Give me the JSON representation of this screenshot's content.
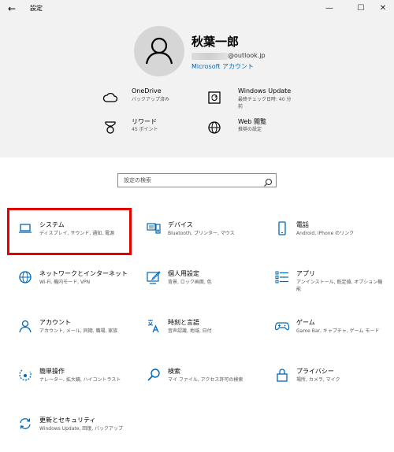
{
  "window": {
    "title": "設定",
    "controls": {
      "back": "←",
      "minimize": "—",
      "maximize": "☐",
      "close": "✕"
    }
  },
  "profile": {
    "name": "秋葉一郎",
    "email_domain": "@outlook.jp",
    "account_link": "Microsoft アカウント",
    "avatar_icon": "person-icon"
  },
  "quick": [
    {
      "label": "OneDrive",
      "sub": "バックアップ済み",
      "icon": "cloud-icon"
    },
    {
      "label": "Windows Update",
      "sub": "最終チェック日時: 40 分前",
      "icon": "update-icon"
    },
    {
      "label": "リワード",
      "sub": "45 ポイント",
      "icon": "medal-icon"
    },
    {
      "label": "Web 閲覧",
      "sub": "推奨の設定",
      "icon": "globe-icon"
    }
  ],
  "search": {
    "placeholder": "設定の検索"
  },
  "categories": [
    {
      "label": "システム",
      "sub": "ディスプレイ, サウンド, 通知, 電源",
      "icon": "laptop-icon"
    },
    {
      "label": "デバイス",
      "sub": "Bluetooth, プリンター, マウス",
      "icon": "devices-icon"
    },
    {
      "label": "電話",
      "sub": "Android, iPhone のリンク",
      "icon": "phone-icon"
    },
    {
      "label": "ネットワークとインターネット",
      "sub": "Wi-Fi, 機内モード, VPN",
      "icon": "network-globe-icon"
    },
    {
      "label": "個人用設定",
      "sub": "背景, ロック画面, 色",
      "icon": "personalize-icon"
    },
    {
      "label": "アプリ",
      "sub": "アンインストール, 既定値, オプション機能",
      "icon": "apps-list-icon"
    },
    {
      "label": "アカウント",
      "sub": "アカウント, メール, 同期, 職場, 家族",
      "icon": "account-icon"
    },
    {
      "label": "時刻と言語",
      "sub": "音声認識, 地域, 日付",
      "icon": "time-language-icon"
    },
    {
      "label": "ゲーム",
      "sub": "Game Bar, キャプチャ, ゲーム モード",
      "icon": "gamepad-icon"
    },
    {
      "label": "簡単操作",
      "sub": "ナレーター, 拡大鏡, ハイコントラスト",
      "icon": "ease-of-access-icon"
    },
    {
      "label": "検索",
      "sub": "マイ ファイル, アクセス許可の検索",
      "icon": "search-icon"
    },
    {
      "label": "プライバシー",
      "sub": "場所, カメラ, マイク",
      "icon": "lock-icon"
    },
    {
      "label": "更新とセキュリティ",
      "sub": "Windows Update, 回復, バックアップ",
      "icon": "sync-icon"
    }
  ],
  "colors": {
    "accent": "#0067b8",
    "highlight": "#e50000",
    "header_bg": "#f2f2f2"
  }
}
